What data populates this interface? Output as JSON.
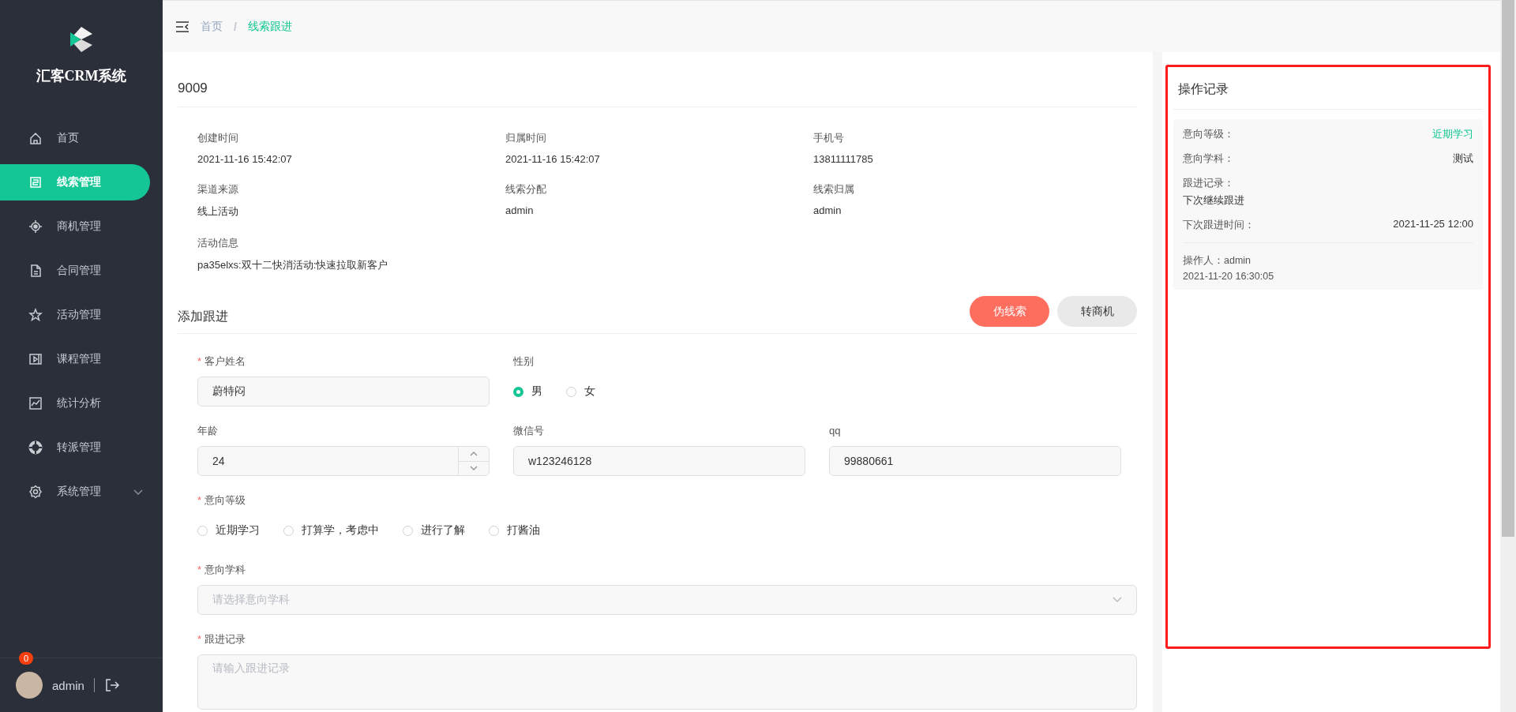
{
  "sidebar": {
    "brand": "汇客CRM系统",
    "menu": [
      {
        "label": "首页",
        "selected": false,
        "expandable": false
      },
      {
        "label": "线索管理",
        "selected": true,
        "expandable": false
      },
      {
        "label": "商机管理",
        "selected": false,
        "expandable": false
      },
      {
        "label": "合同管理",
        "selected": false,
        "expandable": false
      },
      {
        "label": "活动管理",
        "selected": false,
        "expandable": false
      },
      {
        "label": "课程管理",
        "selected": false,
        "expandable": false
      },
      {
        "label": "统计分析",
        "selected": false,
        "expandable": false
      },
      {
        "label": "转派管理",
        "selected": false,
        "expandable": false
      },
      {
        "label": "系统管理",
        "selected": false,
        "expandable": true
      }
    ],
    "user": {
      "name": "admin",
      "badge": "0"
    }
  },
  "header": {
    "separator": "/",
    "breadcrumb": [
      {
        "label": "首页",
        "selected": false
      },
      {
        "label": "线索跟进",
        "selected": true
      }
    ]
  },
  "detail": {
    "title": "9009",
    "fields": [
      {
        "label": "创建时间",
        "value": "2021-11-16 15:42:07"
      },
      {
        "label": "归属时间",
        "value": "2021-11-16 15:42:07"
      },
      {
        "label": "手机号",
        "value": "13811111785"
      },
      {
        "label": "渠道来源",
        "value": "线上活动"
      },
      {
        "label": "线索分配",
        "value": "admin"
      },
      {
        "label": "线索归属",
        "value": "admin"
      },
      {
        "label": "活动信息",
        "value": "pa35elxs:双十二快消活动:快速拉取新客户"
      }
    ]
  },
  "followup": {
    "title": "添加跟进",
    "buttons": [
      {
        "label": "伪线索",
        "kind": "danger"
      },
      {
        "label": "转商机",
        "kind": "default"
      }
    ],
    "rows": [
      [
        {
          "kind": "text",
          "mark": "*",
          "label": "客户姓名",
          "value": "蔚特闷"
        },
        {
          "kind": "radio",
          "label": "性别",
          "options": [
            {
              "label": "男",
              "selected": true
            },
            {
              "label": "女",
              "selected": false
            }
          ]
        }
      ],
      [
        {
          "kind": "number",
          "label": "年龄",
          "value": "24"
        },
        {
          "kind": "text",
          "label": "微信号",
          "value": "w123246128"
        },
        {
          "kind": "text",
          "label": "qq",
          "value": "99880661"
        }
      ],
      [
        {
          "kind": "radio",
          "mark": "*",
          "label": "意向等级",
          "options": [
            {
              "label": "近期学习",
              "selected": false
            },
            {
              "label": "打算学，考虑中",
              "selected": false
            },
            {
              "label": "进行了解",
              "selected": false
            },
            {
              "label": "打酱油",
              "selected": false
            }
          ]
        }
      ],
      [
        {
          "kind": "select",
          "mark": "*",
          "label": "意向学科",
          "placeholder": "请选择意向学科"
        }
      ],
      [
        {
          "kind": "textarea",
          "mark": "*",
          "label": "跟进记录",
          "placeholder": "请输入跟进记录"
        }
      ]
    ]
  },
  "log": {
    "title": "操作记录",
    "entries": [
      {
        "rows": [
          {
            "kind": "accent",
            "label": "意向等级：",
            "value": "近期学习"
          },
          {
            "kind": "plain",
            "label": "意向学科：",
            "value": "测试"
          },
          {
            "kind": "stacked",
            "label": "跟进记录：",
            "value": "下次继续跟进"
          },
          {
            "kind": "plain",
            "label": "下次跟进时间：",
            "value": "2021-11-25 12:00"
          }
        ],
        "operator": "操作人：admin",
        "time": "2021-11-20 16:30:05"
      }
    ]
  }
}
